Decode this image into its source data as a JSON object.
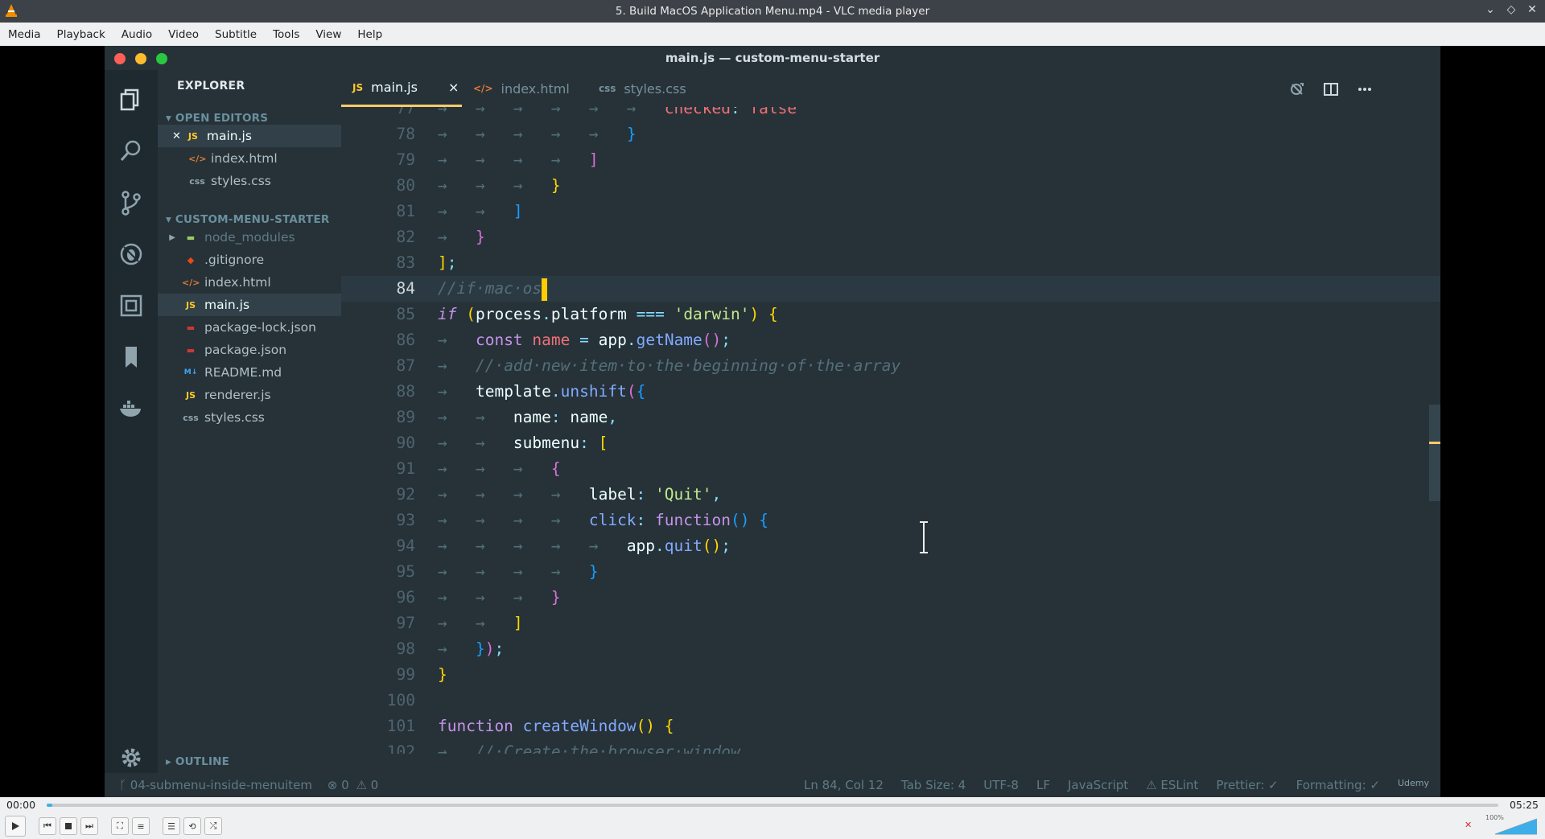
{
  "window": {
    "title": "5. Build MacOS Application Menu.mp4 - VLC media player",
    "menu": [
      "Media",
      "Playback",
      "Audio",
      "Video",
      "Subtitle",
      "Tools",
      "View",
      "Help"
    ]
  },
  "editor": {
    "title": "main.js — custom-menu-starter",
    "explorer_title": "EXPLORER",
    "open_editors_label": "OPEN EDITORS",
    "open_editors": [
      {
        "name": "main.js",
        "icon": "JS",
        "active": true
      },
      {
        "name": "index.html",
        "icon": "</>"
      },
      {
        "name": "styles.css",
        "icon": "css"
      }
    ],
    "project_label": "CUSTOM-MENU-STARTER",
    "files": [
      {
        "name": "node_modules",
        "icon": "folder"
      },
      {
        "name": ".gitignore",
        "icon": "git"
      },
      {
        "name": "index.html",
        "icon": "</>"
      },
      {
        "name": "main.js",
        "icon": "JS",
        "active": true
      },
      {
        "name": "package-lock.json",
        "icon": "npm"
      },
      {
        "name": "package.json",
        "icon": "npm"
      },
      {
        "name": "README.md",
        "icon": "md"
      },
      {
        "name": "renderer.js",
        "icon": "JS"
      },
      {
        "name": "styles.css",
        "icon": "css"
      }
    ],
    "outline_label": "OUTLINE",
    "tabs": [
      {
        "name": "main.js",
        "icon": "JS",
        "active": true,
        "close": "×"
      },
      {
        "name": "index.html",
        "icon": "</>"
      },
      {
        "name": "styles.css",
        "icon": "css"
      }
    ],
    "status": {
      "branch": "04-submenu-inside-menuitem",
      "errors": "0",
      "warnings": "0",
      "position": "Ln 84, Col 12",
      "tab_size": "Tab Size: 4",
      "encoding": "UTF-8",
      "eol": "LF",
      "language": "JavaScript",
      "eslint": "ESLint",
      "prettier": "Prettier: ✓",
      "formatting": "Formatting: ✓",
      "udemy": "Udemy"
    }
  },
  "player": {
    "elapsed": "00:00",
    "total": "05:25",
    "progress": 0.004,
    "volume": "100%"
  }
}
